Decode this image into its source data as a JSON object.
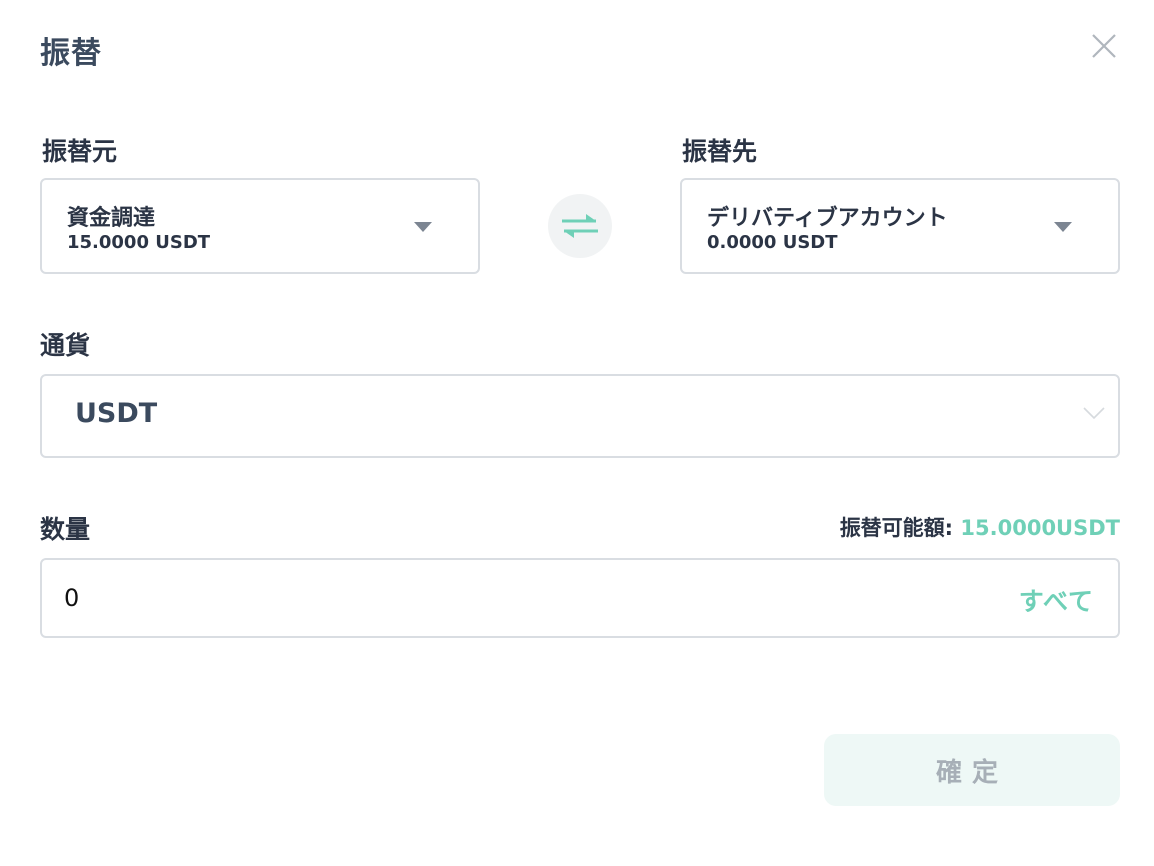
{
  "dialog": {
    "title": "振替"
  },
  "from": {
    "label": "振替元",
    "account_name": "資金調達",
    "balance": "15.0000 USDT"
  },
  "to": {
    "label": "振替先",
    "account_name": "デリバティブアカウント",
    "balance": "0.0000 USDT"
  },
  "currency": {
    "label": "通貨",
    "selected": "USDT"
  },
  "amount": {
    "label": "数量",
    "available_label": "振替可能額:",
    "available_value": "15.0000USDT",
    "value": "0",
    "all_label": "すべて"
  },
  "confirm": {
    "label": "確定"
  },
  "colors": {
    "accent": "#6fd0b7",
    "text": "#2b3445",
    "border": "#d9dde2",
    "confirm_bg": "#eef8f6"
  },
  "icons": {
    "close": "close-icon",
    "swap": "swap-arrows-icon",
    "dropdown": "caret-down-icon",
    "chevron": "chevron-down-icon"
  }
}
